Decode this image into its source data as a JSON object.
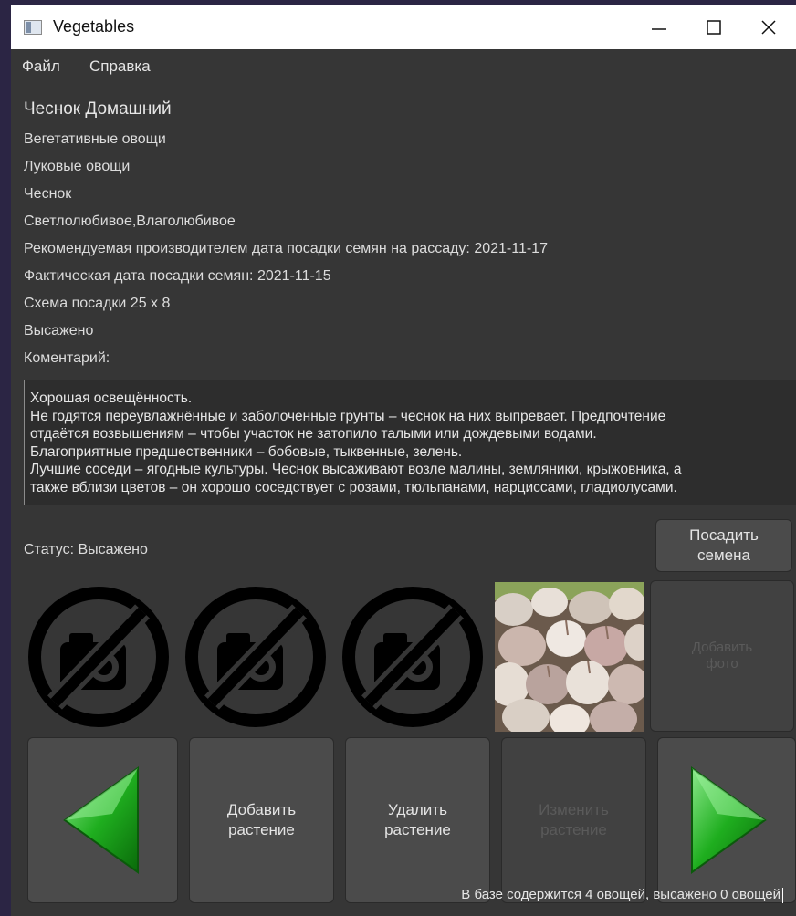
{
  "window": {
    "title": "Vegetables"
  },
  "menu": {
    "file": "Файл",
    "help": "Справка"
  },
  "plant": {
    "name": "Чеснок Домашний",
    "group": "Вегетативные овощи",
    "family": "Луковые овощи",
    "kind": "Чеснок",
    "properties": "Светлолюбивое,Влаголюбивое",
    "recommended_date": "Рекомендуемая производителем дата посадки семян на рассаду: 2021-11-17",
    "actual_date": "Фактическая дата посадки семян:  2021-11-15",
    "scheme": "Схема посадки 25 х 8",
    "planted": "Высажено",
    "comment_label": "Коментарий:",
    "comment_lines": [
      "Хорошая освещённость.",
      "Не годятся переувлажнённые и заболоченные грунты – чеснок на них выпревает. Предпочтение",
      "отдаётся возвышениям – чтобы участок не затопило талыми или дождевыми водами.",
      "Благоприятные предшественники – бобовые, тыквенные, зелень.",
      "Лучшие соседи – ягодные культуры. Чеснок высаживают возле малины, земляники, крыжовника, а",
      "также вблизи цветов – он хорошо соседствует с розами, тюльпанами, нарциссами, гладиолусами."
    ]
  },
  "status": {
    "label": "Статус:  Высажено"
  },
  "buttons": {
    "plant_seeds_line1": "Посадить",
    "plant_seeds_line2": "семена",
    "add_photo_line1": "Добавить",
    "add_photo_line2": "фото",
    "add_plant_line1": "Добавить",
    "add_plant_line2": "растение",
    "delete_plant_line1": "Удалить",
    "delete_plant_line2": "растение",
    "edit_plant_line1": "Изменить",
    "edit_plant_line2": "растение"
  },
  "icons": {
    "prev": "green-left-arrow-icon",
    "next": "green-right-arrow-icon",
    "no_photo": "no-photo-icon"
  },
  "colors": {
    "arrow_green": "#19a619",
    "arrow_light": "#7ee07e",
    "background": "#363636"
  },
  "statusbar": {
    "text": "В базе содержится 4 овощей, высажено 0 овощей"
  }
}
